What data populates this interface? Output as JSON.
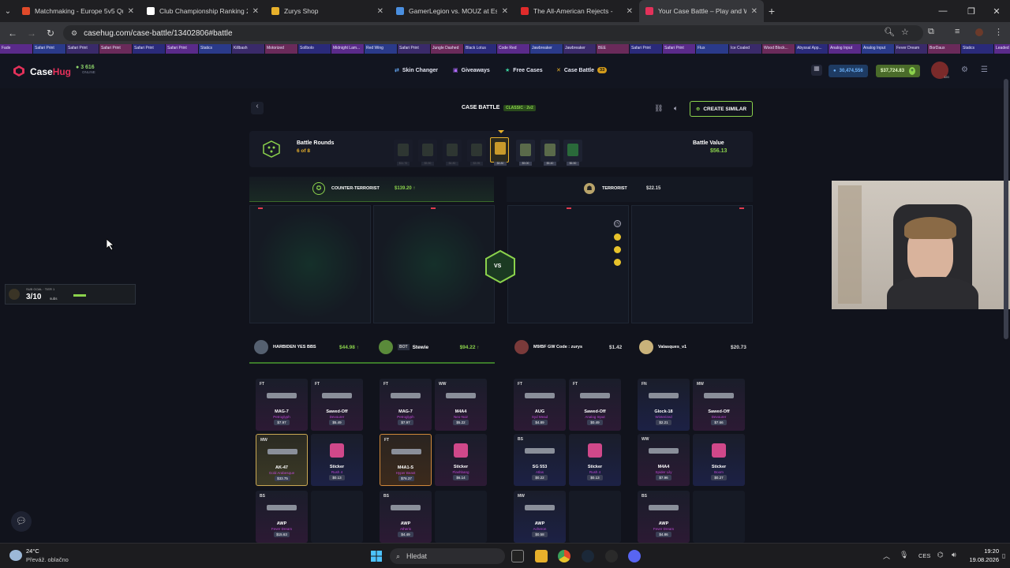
{
  "browser": {
    "tabs": [
      {
        "title": "Matchmaking - Europe 5v5 Qu",
        "color": "#e04a2a"
      },
      {
        "title": "Club Championship Ranking 20",
        "color": "#ffffff"
      },
      {
        "title": "Zurys Shop",
        "color": "#e7b02b"
      },
      {
        "title": "GamerLegion vs. MOUZ at Esp",
        "color": "#4a8fe0"
      },
      {
        "title": "The All-American Rejects -",
        "color": "#e02b2b"
      },
      {
        "title": "Your Case Battle – Play and Wi",
        "color": "#e3315a"
      }
    ],
    "url": "casehug.com/case-battle/13402806#battle"
  },
  "ticker": [
    "Fade",
    "Safari Print",
    "Safari Print",
    "Safari Print",
    "Safari Print",
    "Safari Print",
    "Statics",
    "Killbash",
    "Motorized",
    "Sollbolo",
    "Midnight Lam...",
    "Red Wing",
    "Safari Print",
    "Jungle Dashed",
    "Black Lotus",
    "Code Red",
    "Jawbreaker",
    "Jawbreaker",
    "BEE",
    "Safari Print",
    "Safari Print",
    "Flux",
    "Ice Coaled",
    "Wood Block...",
    "Abyssal App...",
    "Analog Input",
    "Analog Input",
    "Fever Dream",
    "BorDaux",
    "Statics",
    "Leaded Gl..."
  ],
  "site": {
    "logo_a": "Case",
    "logo_b": "Hug",
    "online_count": "3 616",
    "online_label": "ONLINE",
    "nav": [
      {
        "icon": "swap-icon",
        "label": "Skin Changer"
      },
      {
        "icon": "gift-icon",
        "label": "Giveaways"
      },
      {
        "icon": "star-icon",
        "label": "Free Cases"
      },
      {
        "icon": "swords-icon",
        "label": "Case Battle",
        "badge": "33"
      }
    ],
    "coins": "30,474,556",
    "balance": "$37,724.83",
    "avatar_level": "120"
  },
  "battle": {
    "title": "CASE BATTLE",
    "mode": "CLASSIC · 2v2",
    "create_similar": "CREATE SIMILAR",
    "rounds_label": "Battle Rounds",
    "rounds_value": "6 of 8",
    "value_label": "Battle Value",
    "value": "$56.13",
    "round_prices": [
      "$11.70",
      "$5.50",
      "$4.80",
      "$3.95",
      "$8.80",
      "$9.00",
      "$5.40",
      "$6.50"
    ],
    "team_ct": {
      "name": "COUNTER-TERRORIST",
      "total": "$139.20 ↑"
    },
    "team_t": {
      "name": "TERRORIST",
      "total": "$22.15"
    },
    "vs": "VS",
    "players": [
      {
        "name": "HARBIDEN YES BBS",
        "value": "$44.98 ↑"
      },
      {
        "name": "Stewie",
        "prefix": "BOT",
        "value": "$94.22 ↑"
      },
      {
        "name": "M9/BF GW Code : zurys",
        "value": "$1.42"
      },
      {
        "name": "Valasques_v1",
        "value": "$20.73"
      }
    ],
    "items": [
      {
        "cond": "FT",
        "name": "MAG-7",
        "skin": "Petroglyph",
        "price": "$7.97",
        "style": ""
      },
      {
        "cond": "FT",
        "name": "Sawed-Off",
        "skin": "Devourer",
        "price": "$5.49",
        "style": ""
      },
      {
        "cond": "FT",
        "name": "MAG-7",
        "skin": "Petroglyph",
        "price": "$7.97",
        "style": ""
      },
      {
        "cond": "WW",
        "name": "M4A4",
        "skin": "Neo-Noir",
        "price": "$5.22",
        "style": ""
      },
      {
        "cond": "FT",
        "name": "AUG",
        "skin": "Syd Mead",
        "price": "$4.89",
        "style": ""
      },
      {
        "cond": "FT",
        "name": "Sawed-Off",
        "skin": "Analog Input",
        "price": "$0.49",
        "style": ""
      },
      {
        "cond": "FN",
        "name": "Glock-18",
        "skin": "Winterized",
        "price": "$2.21",
        "style": "blue"
      },
      {
        "cond": "MW",
        "name": "Sawed-Off",
        "skin": "Devourer",
        "price": "$7.66",
        "style": ""
      },
      {
        "cond": "MW",
        "name": "AK-47",
        "skin": "Gold Arabesque",
        "price": "$33.75",
        "style": "gold"
      },
      {
        "cond": "",
        "name": "Sticker",
        "skin": "Rush 4",
        "price": "$0.13",
        "style": "blue"
      },
      {
        "cond": "FT",
        "name": "M4A1-S",
        "skin": "Hyper Beast",
        "price": "$76.37",
        "style": "orange"
      },
      {
        "cond": "",
        "name": "Sticker",
        "skin": "Flashbang",
        "price": "$6.14",
        "style": ""
      },
      {
        "cond": "BS",
        "name": "SG 553",
        "skin": "Atlas",
        "price": "$0.22",
        "style": "blue"
      },
      {
        "cond": "",
        "name": "Sticker",
        "skin": "Rush 4",
        "price": "$0.13",
        "style": "blue"
      },
      {
        "cond": "WW",
        "name": "M4A4",
        "skin": "Spider Lily",
        "price": "$7.96",
        "style": ""
      },
      {
        "cond": "",
        "name": "Sticker",
        "skin": "Boom",
        "price": "$0.27",
        "style": "blue"
      },
      {
        "cond": "BS",
        "name": "AWP",
        "skin": "Fever Dream",
        "price": "$15.63",
        "style": ""
      },
      {
        "cond": "BS",
        "name": "AWP",
        "skin": "Atheris",
        "price": "$4.49",
        "style": ""
      },
      {
        "cond": "MW",
        "name": "AWP",
        "skin": "Acheron",
        "price": "$0.58",
        "style": "blue"
      },
      {
        "cond": "BS",
        "name": "AWP",
        "skin": "Fever Dream",
        "price": "$4.86",
        "style": ""
      }
    ]
  },
  "mini_widget": {
    "label": "SUB GOAL · TIER 1",
    "progress": "3/10",
    "unit": "subs"
  },
  "taskbar": {
    "temp": "24°C",
    "weather": "Převáž. oblačno",
    "search": "Hledat",
    "lang": "CES",
    "time": "19:20",
    "date": "19.08.2026"
  },
  "colors": {
    "accent": "#8bd24c",
    "brand": "#e3315a",
    "bg": "#11131c"
  }
}
